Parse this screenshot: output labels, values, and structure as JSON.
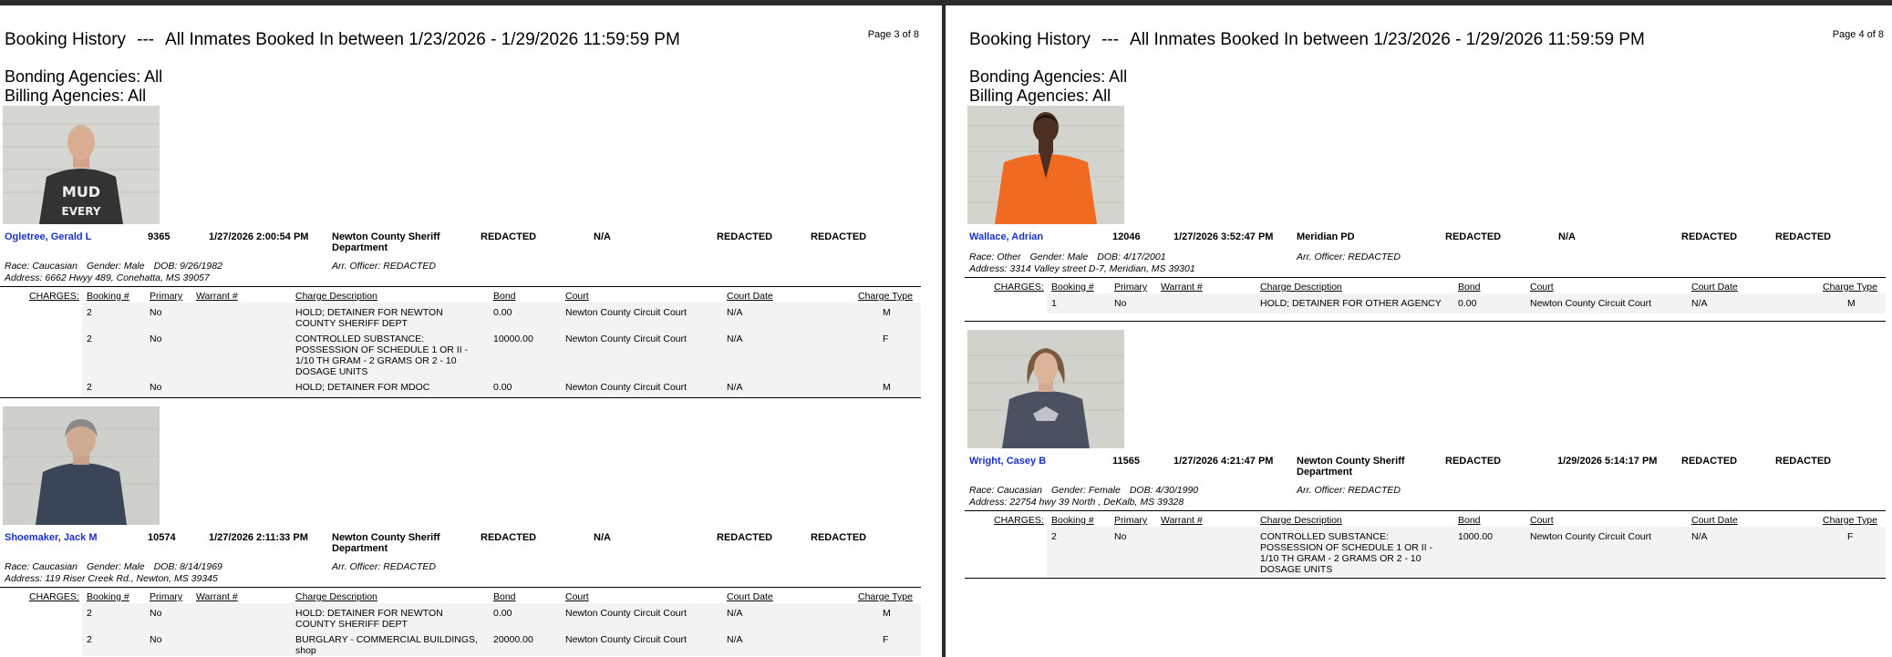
{
  "report": {
    "title": "Booking History",
    "separator": "---",
    "subtitle": "All Inmates Booked In between 1/23/2026 - 1/29/2026 11:59:59 PM",
    "bonding": "Bonding Agencies: All",
    "billing": "Billing Agencies: All",
    "charges_label": "CHARGES:",
    "arr_officer": "Arr. Officer: REDACTED",
    "charge_headers": [
      "Booking #",
      "Primary",
      "Warrant #",
      "Charge Description",
      "Bond",
      "Court",
      "Court Date",
      "Charge Type"
    ]
  },
  "pages": [
    {
      "page_label": "Page 3 of 8",
      "inmates": [
        {
          "name": "Ogletree, Gerald L",
          "booking_no": "9365",
          "booking_date": "1/27/2026 2:00:54 PM",
          "agency": "Newton County Sheriff Department",
          "f5": "REDACTED",
          "f6": "N/A",
          "f7": "REDACTED",
          "f8": "REDACTED",
          "race": "Race: Caucasian",
          "gender": "Gender: Male",
          "dob": "DOB:  9/26/1982",
          "address": "Address: 6662 Hwyy 489, Conehatta, MS 39057",
          "charges": [
            {
              "booking": "2",
              "primary": "No",
              "desc": "HOLD; DETAINER FOR NEWTON COUNTY SHERIFF DEPT",
              "bond": "0.00",
              "court": "Newton County Circuit Court",
              "court_date": "N/A",
              "type": "M"
            },
            {
              "booking": "2",
              "primary": "No",
              "desc": "CONTROLLED SUBSTANCE: POSSESSION OF SCHEDULE 1 OR II - 1/10 TH GRAM - 2 GRAMS OR 2 - 10 DOSAGE UNITS",
              "bond": "10000.00",
              "court": "Newton County Circuit Court",
              "court_date": "N/A",
              "type": "F"
            },
            {
              "booking": "2",
              "primary": "No",
              "desc": "HOLD; DETAINER FOR MDOC",
              "bond": "0.00",
              "court": "Newton County Circuit Court",
              "court_date": "N/A",
              "type": "M"
            }
          ]
        },
        {
          "name": "Shoemaker, Jack M",
          "booking_no": "10574",
          "booking_date": "1/27/2026 2:11:33 PM",
          "agency": "Newton County Sheriff Department",
          "f5": "REDACTED",
          "f6": "N/A",
          "f7": "REDACTED",
          "f8": "REDACTED",
          "race": "Race: Caucasian",
          "gender": "Gender: Male",
          "dob": "DOB:  8/14/1969",
          "address": "Address: 119 Riser Creek Rd., Newton, MS 39345",
          "charges": [
            {
              "booking": "2",
              "primary": "No",
              "desc": "HOLD: DETAINER FOR NEWTON COUNTY SHERIFF DEPT",
              "bond": "0.00",
              "court": "Newton County Circuit Court",
              "court_date": "N/A",
              "type": "M"
            },
            {
              "booking": "2",
              "primary": "No",
              "desc": "BURGLARY - COMMERCIAL  BUILDINGS, shop",
              "bond": "20000.00",
              "court": "Newton County Circuit Court",
              "court_date": "N/A",
              "type": "F"
            }
          ]
        }
      ]
    },
    {
      "page_label": "Page 4 of 8",
      "inmates": [
        {
          "name": "Wallace, Adrian",
          "booking_no": "12046",
          "booking_date": "1/27/2026 3:52:47 PM",
          "agency": "Meridian PD",
          "f5": "REDACTED",
          "f6": "N/A",
          "f7": "REDACTED",
          "f8": "REDACTED",
          "race": "Race: Other",
          "gender": "Gender: Male",
          "dob": "DOB:  4/17/2001",
          "address": "Address: 3314 Valley street D-7, Meridian, MS 39301",
          "charges": [
            {
              "booking": "1",
              "primary": "No",
              "desc": "HOLD; DETAINER FOR OTHER AGENCY",
              "bond": "0.00",
              "court": "Newton County Circuit Court",
              "court_date": "N/A",
              "type": "M"
            }
          ]
        },
        {
          "name": "Wright, Casey B",
          "booking_no": "11565",
          "booking_date": "1/27/2026 4:21:47 PM",
          "agency": "Newton County Sheriff Department",
          "f5": "REDACTED",
          "f6": "1/29/2026 5:14:17 PM",
          "f7": "REDACTED",
          "f8": "REDACTED",
          "race": "Race: Caucasian",
          "gender": "Gender: Female",
          "dob": "DOB:  4/30/1990",
          "address": "Address: 22754 hwy 39 North , DeKalb, MS 39328",
          "charges": [
            {
              "booking": "2",
              "primary": "No",
              "desc": "CONTROLLED SUBSTANCE: POSSESSION OF SCHEDULE 1 OR II - 1/10 TH GRAM - 2 GRAMS OR 2 - 10 DOSAGE UNITS",
              "bond": "1000.00",
              "court": "Newton County Circuit Court",
              "court_date": "N/A",
              "type": "F"
            }
          ]
        }
      ]
    }
  ]
}
